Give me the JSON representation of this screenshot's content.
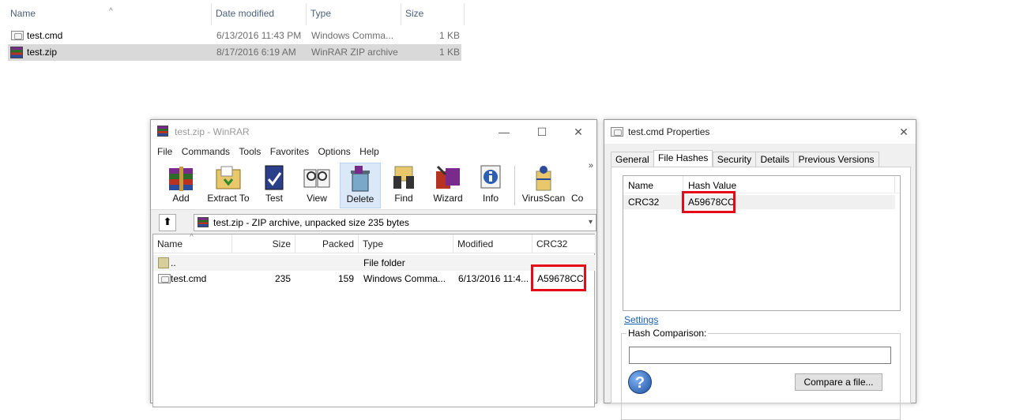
{
  "explorer": {
    "columns": {
      "name": "Name",
      "date": "Date modified",
      "type": "Type",
      "size": "Size"
    },
    "rows": [
      {
        "name": "test.cmd",
        "date": "6/13/2016 11:43 PM",
        "type": "Windows Comma...",
        "size": "1 KB",
        "icon": "cmd-file-icon"
      },
      {
        "name": "test.zip",
        "date": "8/17/2016 6:19 AM",
        "type": "WinRAR ZIP archive",
        "size": "1 KB",
        "icon": "winrar-archive-icon"
      }
    ]
  },
  "winrar": {
    "title": "test.zip - WinRAR",
    "menu": [
      "File",
      "Commands",
      "Tools",
      "Favorites",
      "Options",
      "Help"
    ],
    "toolbar": [
      "Add",
      "Extract To",
      "Test",
      "View",
      "Delete",
      "Find",
      "Wizard",
      "Info",
      "VirusScan",
      "Co"
    ],
    "more": "»",
    "address": "test.zip - ZIP archive, unpacked size 235 bytes",
    "columns": {
      "name": "Name",
      "size": "Size",
      "packed": "Packed",
      "type": "Type",
      "modified": "Modified",
      "crc": "CRC32"
    },
    "rows": [
      {
        "name": "..",
        "size": "",
        "packed": "",
        "type": "File folder",
        "modified": "",
        "crc": ""
      },
      {
        "name": "test.cmd",
        "size": "235",
        "packed": "159",
        "type": "Windows Comma...",
        "modified": "6/13/2016 11:4...",
        "crc": "A59678CC"
      }
    ]
  },
  "props": {
    "title": "test.cmd Properties",
    "tabs": [
      "General",
      "File Hashes",
      "Security",
      "Details",
      "Previous Versions"
    ],
    "hash_columns": {
      "name": "Name",
      "value": "Hash Value"
    },
    "hash_row": {
      "name": "CRC32",
      "value": "A59678CC"
    },
    "settings": "Settings",
    "comparison_label": "Hash Comparison:",
    "compare_button": "Compare a file..."
  },
  "colors": {
    "highlight_box": "#e30b18",
    "link": "#1a5fb4"
  }
}
